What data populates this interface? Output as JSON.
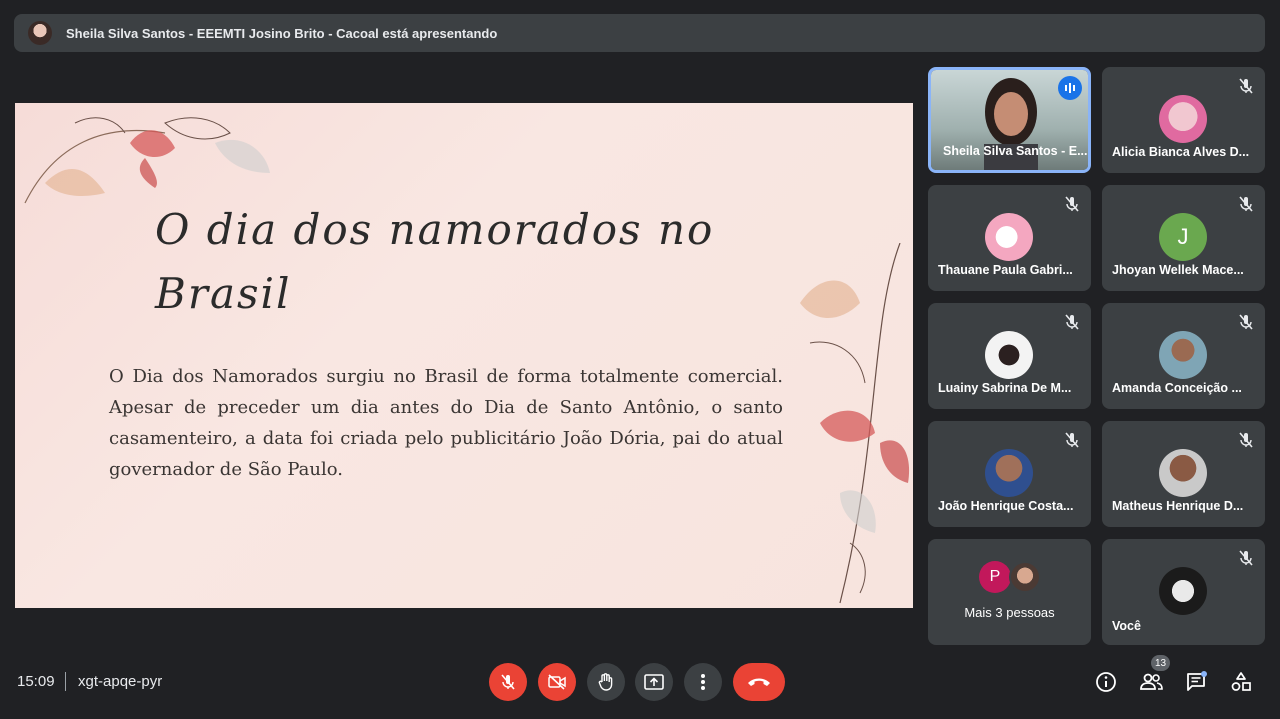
{
  "topbar": {
    "presenter_text": "Sheila Silva Santos - EEEMTI Josino Brito - Cacoal está apresentando"
  },
  "slide": {
    "heading": "O dia dos namorados no Brasil",
    "body": "O Dia dos Namorados surgiu no Brasil de forma totalmente comercial. Apesar de preceder um dia antes do Dia de Santo Antônio, o santo casamenteiro, a data foi criada pelo publicitário João Dória, pai do atual governador de São Paulo."
  },
  "participants": [
    {
      "name": "Sheila Silva Santos - E...",
      "muted": false,
      "speaking": true
    },
    {
      "name": "Alicia Bianca Alves D...",
      "muted": true
    },
    {
      "name": "Thauane Paula Gabri...",
      "muted": true
    },
    {
      "name": "Jhoyan Wellek Mace...",
      "muted": true,
      "initial": "J",
      "avatar_color": "#6aa84f"
    },
    {
      "name": "Luainy Sabrina De M...",
      "muted": true
    },
    {
      "name": "Amanda Conceição ...",
      "muted": true
    },
    {
      "name": "João Henrique Costa...",
      "muted": true
    },
    {
      "name": "Matheus Henrique D...",
      "muted": true
    },
    {
      "name": "Mais 3 pessoas",
      "initial": "P",
      "avatar_color": "#c2185b"
    },
    {
      "name": "Você",
      "muted": true
    }
  ],
  "bottombar": {
    "time": "15:09",
    "meeting_code": "xgt-apqe-pyr",
    "participant_count": "13"
  },
  "colors": {
    "accent": "#8ab4f8",
    "danger": "#ea4335",
    "surface": "#3c4043",
    "background": "#202124"
  }
}
